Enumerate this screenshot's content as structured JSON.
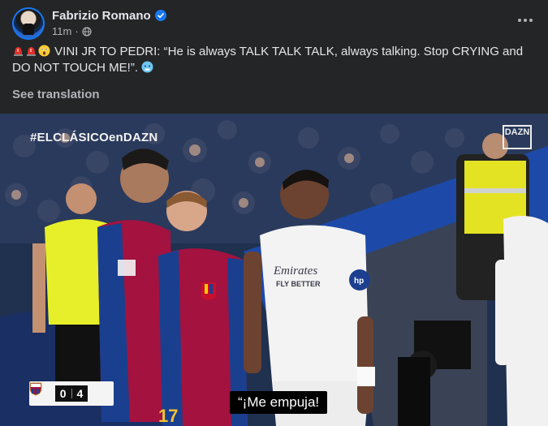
{
  "post": {
    "author": "Fabrizio Romano",
    "time": "11m",
    "separator": "·",
    "prefix": "VINI JR TO PEDRI: “He is always TALK TALK TALK, always talking. Stop CRYING and DO NOT TOUCH ME!”.",
    "see_translation": "See translation",
    "emojis": [
      "siren",
      "siren",
      "astonished",
      "cold-face"
    ]
  },
  "media": {
    "hashtag": "#ELCLÁSICOenDAZN",
    "broadcaster": "DAZN",
    "score_home": "0",
    "score_away": "4",
    "subtitle": "“¡Me empuja!",
    "jersey_number": "17"
  },
  "colors": {
    "bg": "#242526",
    "text": "#e4e6eb",
    "muted": "#b0b3b8",
    "verified": "#1877f2",
    "barca_blue": "#1b3f8f",
    "barca_red": "#a4123f",
    "referee_yellow": "#e7ef2a"
  },
  "icons": {
    "verified": "verified-badge-icon",
    "globe": "globe-icon",
    "more": "more-options-icon"
  }
}
